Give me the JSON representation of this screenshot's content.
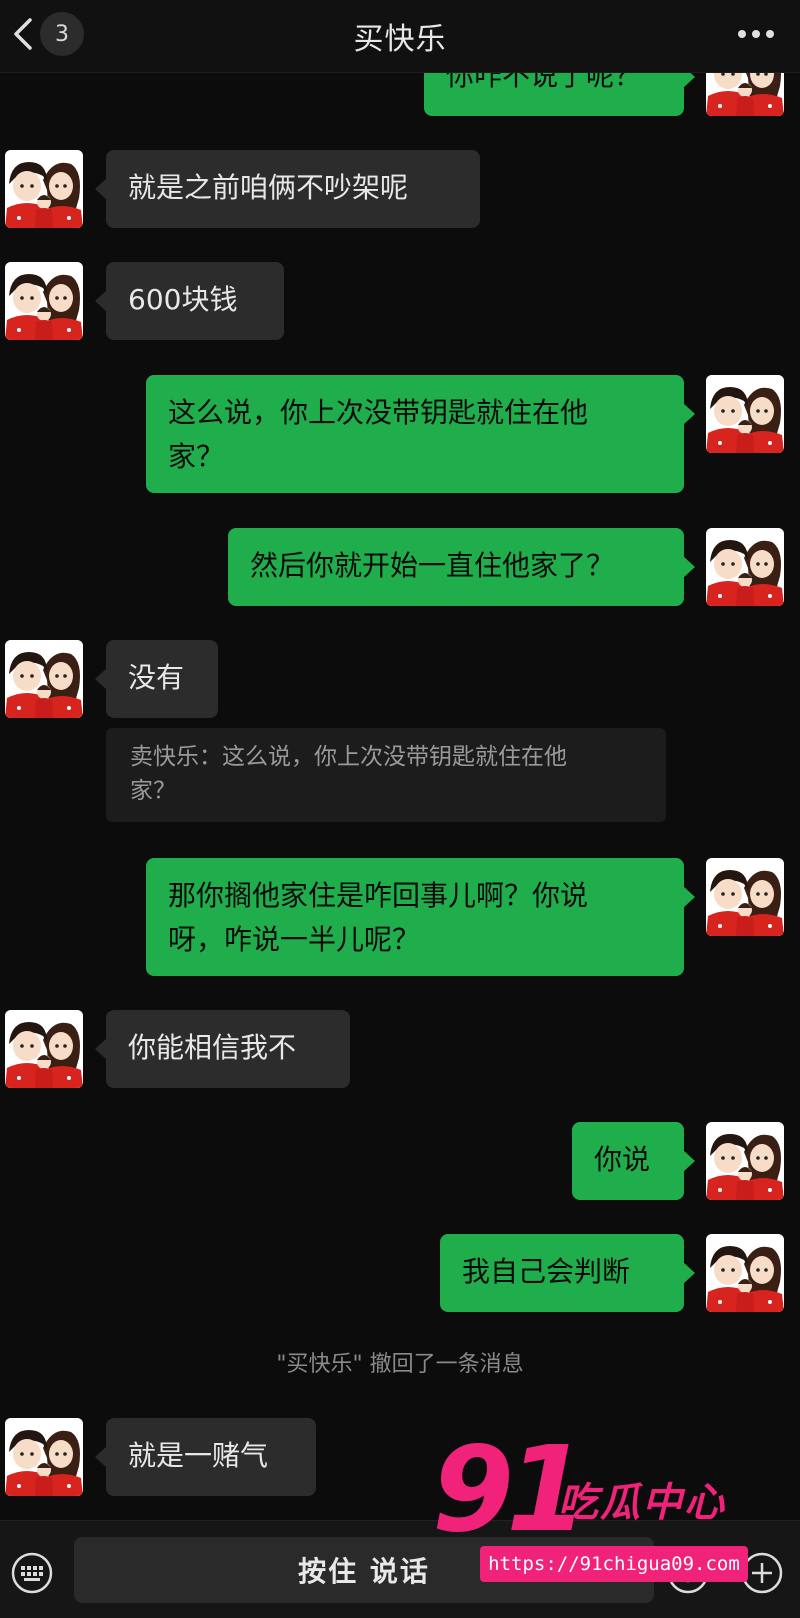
{
  "header": {
    "title": "买快乐",
    "unread_count": "3",
    "back_icon": "chevron-left-icon",
    "more_icon": "ellipsis-icon"
  },
  "messages": [
    {
      "side": "out",
      "text": "你咋不说了呢？"
    },
    {
      "side": "in",
      "text": "就是之前咱俩不吵架呢"
    },
    {
      "side": "in",
      "text": "600块钱"
    },
    {
      "side": "out",
      "text": "这么说，你上次没带钥匙就住在他\n家？"
    },
    {
      "side": "out",
      "text": "然后你就开始一直住他家了？"
    },
    {
      "side": "in",
      "text": "没有"
    },
    {
      "side": "quote",
      "text": "卖快乐：这么说，你上次没带钥匙就住在他\n家？"
    },
    {
      "side": "out",
      "text": "那你搁他家住是咋回事儿啊？你说\n呀，咋说一半儿呢？"
    },
    {
      "side": "in",
      "text": "你能相信我不"
    },
    {
      "side": "out",
      "text": "你说"
    },
    {
      "side": "out",
      "text": "我自己会判断"
    },
    {
      "side": "system",
      "text": "\"买快乐\" 撤回了一条消息"
    },
    {
      "side": "in",
      "text": "就是一赌气"
    }
  ],
  "bottom_bar": {
    "voice_label": "按住 说话",
    "keyboard_icon": "keyboard-icon",
    "emoji_icon": "emoji-icon",
    "plus_icon": "plus-circle-icon"
  },
  "watermark": {
    "number": "91",
    "text": "吃瓜中心",
    "url": "https://91chigua09.com",
    "color": "#f0227a"
  },
  "colors": {
    "background": "#0c0c0c",
    "incoming_bubble": "#2c2c2c",
    "outgoing_bubble": "#1fae4b"
  }
}
